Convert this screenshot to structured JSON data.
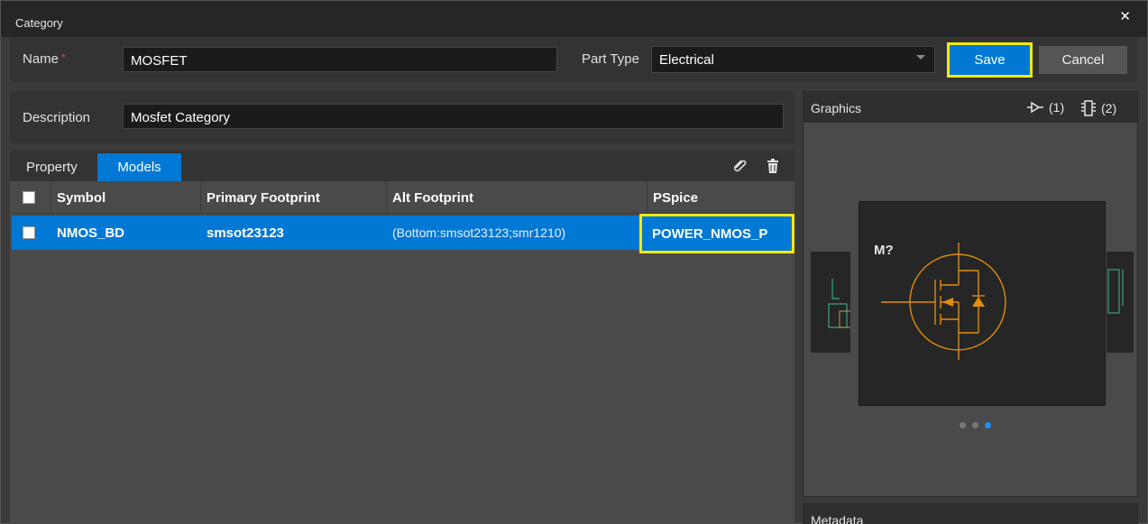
{
  "window": {
    "title": "Category",
    "close_glyph": "✕"
  },
  "form": {
    "name_label": "Name",
    "required_mark": "*",
    "name_value": "MOSFET",
    "part_type_label": "Part Type",
    "part_type_value": "Electrical",
    "description_label": "Description",
    "description_value": "Mosfet Category"
  },
  "buttons": {
    "save": "Save",
    "cancel": "Cancel"
  },
  "tabs": [
    {
      "label": "Property"
    },
    {
      "label": "Models"
    }
  ],
  "grid": {
    "columns": [
      "Symbol",
      "Primary Footprint",
      "Alt Footprint",
      "PSpice"
    ],
    "rows": [
      {
        "symbol": "NMOS_BD",
        "primary_footprint": "smsot23123",
        "alt_footprint": "(Bottom:smsot23123;smr1210)",
        "pspice": "POWER_NMOS_P"
      }
    ]
  },
  "graphics": {
    "title": "Graphics",
    "symbol_count": "(1)",
    "footprint_count": "(2)",
    "refdes": "M?",
    "carousel_pages": 3,
    "carousel_active": 3
  },
  "metadata": {
    "title": "Metadata"
  },
  "colors": {
    "accent": "#0078d4",
    "highlight": "#f4ea12",
    "symbol_stroke": "#e08e0b"
  }
}
